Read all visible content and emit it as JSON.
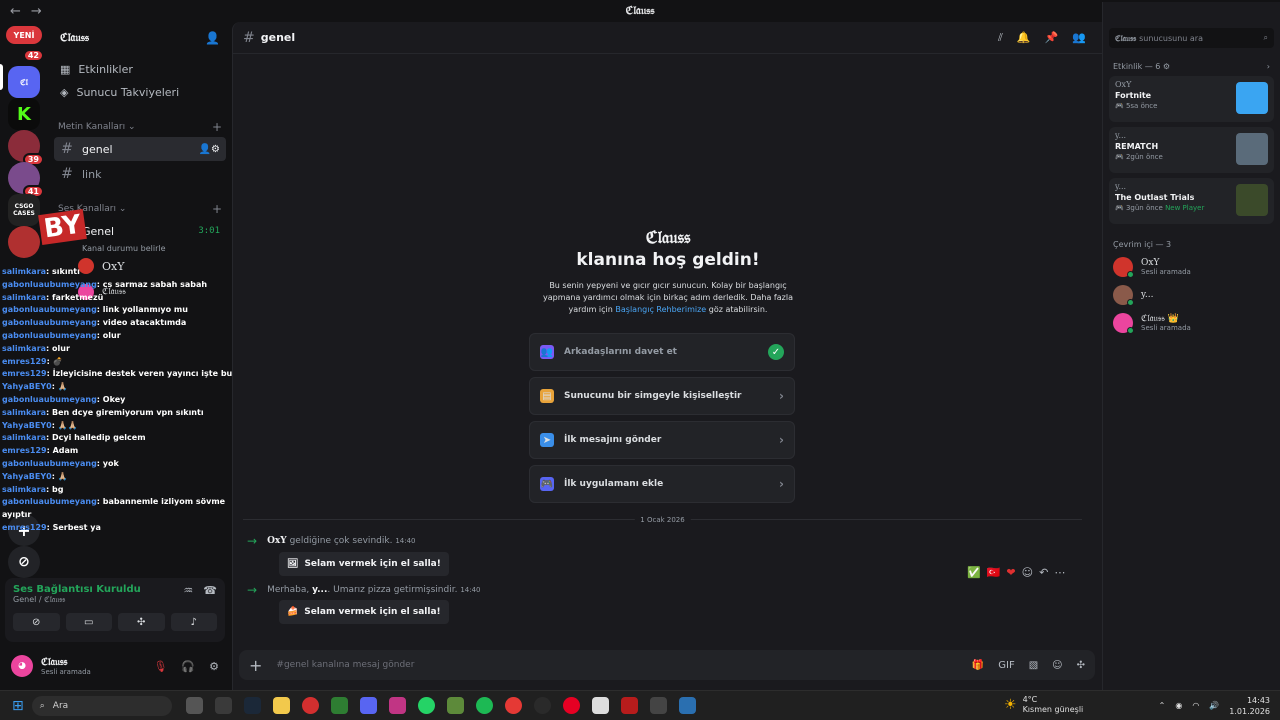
{
  "window": {
    "title": "ℭ𝔩𝔞𝔲𝔰𝔰"
  },
  "rail": {
    "new_badge": "YENİ",
    "badge_top": "42",
    "badges": [
      "39",
      "41"
    ],
    "cases_label": "CSGO CASES",
    "add_label": "+",
    "discover_label": "⊘"
  },
  "sidebar": {
    "server_name": "ℭ𝔩𝔞𝔲𝔰𝔰",
    "nav": [
      {
        "label": "Etkinlikler"
      },
      {
        "label": "Sunucu Takviyeleri"
      }
    ],
    "text_category": "Metin Kanalları",
    "text_channels": [
      {
        "label": "genel"
      },
      {
        "label": "link"
      }
    ],
    "voice_category": "Ses Kanalları",
    "voice_channel": {
      "label": "Genel",
      "time": "3:01",
      "status": "Kanal durumu belirle"
    },
    "voice_users": [
      {
        "name": "OxY"
      },
      {
        "name": "ℭ𝔩𝔞𝔲𝔰𝔰"
      }
    ]
  },
  "overlay": {
    "stamp": "BY",
    "lines": [
      {
        "user": "salimkara",
        "text": "sıkıntı"
      },
      {
        "user": "gabonluaubumeyang",
        "text": "cs sarmaz sabah sabah"
      },
      {
        "user": "salimkara",
        "text": "farketmezü"
      },
      {
        "user": "gabonluaubumeyang",
        "text": "link yollanmıyo mu"
      },
      {
        "user": "gabonluaubumeyang",
        "text": "video atacaktımda"
      },
      {
        "user": "gabonluaubumeyang",
        "text": "olur"
      },
      {
        "user": "salimkara",
        "text": "olur"
      },
      {
        "user": "emres129",
        "text": "💣"
      },
      {
        "user": "emres129",
        "text": "İzleyicisine destek veren yayıncı işte bu"
      },
      {
        "user": "YahyaBEY0",
        "text": "🙏🏼"
      },
      {
        "user": "gabonluaubumeyang",
        "text": "Okey"
      },
      {
        "user": "salimkara",
        "text": "Ben dcye giremiyorum vpn sıkıntı"
      },
      {
        "user": "YahyaBEY0",
        "text": "🙏🏼🙏🏼"
      },
      {
        "user": "salimkara",
        "text": "Dcyi halledip gelcem"
      },
      {
        "user": "emres129",
        "text": "Adam"
      },
      {
        "user": "gabonluaubumeyang",
        "text": "yok"
      },
      {
        "user": "YahyaBEY0",
        "text": "🙏🏼"
      },
      {
        "user": "salimkara",
        "text": "bg"
      },
      {
        "user": "gabonluaubumeyang",
        "text": "babannemle izliyom sövme ayıptır"
      },
      {
        "user": "emres129",
        "text": "Serbest ya"
      }
    ]
  },
  "voice_panel": {
    "status": "Ses Bağlantısı Kuruldu",
    "location": "Genel / ℭ𝔩𝔞𝔲𝔰𝔰"
  },
  "user_panel": {
    "name": "ℭ𝔩𝔞𝔲𝔰𝔰",
    "status": "Sesli aramada"
  },
  "main": {
    "channel": "genel",
    "welcome_server": "ℭ𝔩𝔞𝔲𝔰𝔰",
    "welcome_title": "klanına hoş geldin!",
    "welcome_desc_1": "Bu senin yepyeni ve gıcır gıcır sunucun. Kolay bir başlangıç yapmana yardımcı olmak için birkaç adım derledik. Daha fazla yardım için ",
    "welcome_link": "Başlangıç Rehberimize",
    "welcome_desc_2": " göz atabilirsin.",
    "cards": [
      {
        "label": "Arkadaşlarını davet et",
        "done": true
      },
      {
        "label": "Sunucunu bir simgeyle kişiselleştir"
      },
      {
        "label": "İlk mesajını gönder"
      },
      {
        "label": "İlk uygulamanı ekle"
      }
    ],
    "date_divider": "1 Ocak 2026",
    "messages": [
      {
        "name": "OxY",
        "text": "geldiğine çok sevindik.",
        "time": "14:40",
        "button": "Selam vermek için el salla!"
      },
      {
        "prefix": "Merhaba, ",
        "name": "y...",
        "text": ". Umarız pizza getirmişsindir.",
        "time": "14:40",
        "button": "Selam vermek için el salla!"
      }
    ],
    "composer_placeholder": "#genel kanalına mesaj gönder"
  },
  "right_panel": {
    "search_server": "ℭ𝔩𝔞𝔲𝔰𝔰",
    "search_placeholder": "sunucusunu ara",
    "activity_header": "Etkinlik — 6",
    "activities": [
      {
        "who": "OxY",
        "game": "Fortnite",
        "ago": "5sa önce",
        "art_color": "#3aa5f2"
      },
      {
        "who": "y...",
        "game": "REMATCH",
        "ago": "2gün önce",
        "art_color": "#5a6b7a"
      },
      {
        "who": "y...",
        "game": "The Outlast Trials",
        "ago": "3gün önce",
        "extra": "New Player",
        "art_color": "#3b4a2a"
      }
    ],
    "online_header": "Çevrim içi — 3",
    "members": [
      {
        "name": "OxY",
        "status": "Sesli aramada",
        "color": "#d0342c"
      },
      {
        "name": "y...",
        "status": "",
        "color": "#8a5a4a"
      },
      {
        "name": "ℭ𝔩𝔞𝔲𝔰𝔰 👑",
        "status": "Sesli aramada",
        "color": "#eb459e"
      }
    ]
  },
  "taskbar": {
    "search": "Ara",
    "weather_temp": "4°C",
    "weather_desc": "Kısmen güneşli",
    "time": "14:43",
    "date": "1.01.2026"
  }
}
